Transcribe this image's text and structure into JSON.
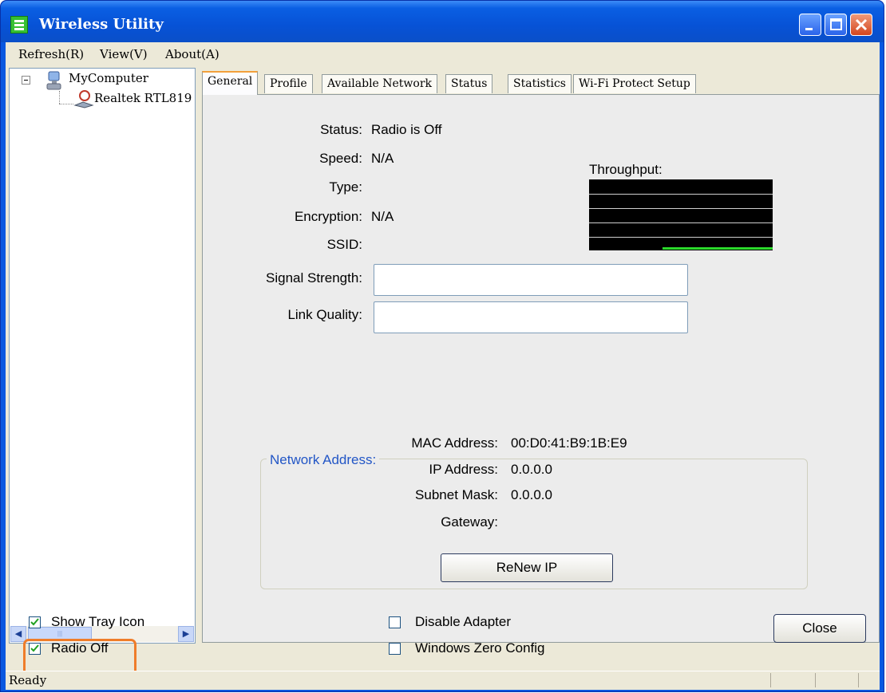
{
  "window": {
    "title": "Wireless Utility"
  },
  "menu": {
    "refresh": "Refresh(R)",
    "view": "View(V)",
    "about": "About(A)"
  },
  "tree": {
    "root": "MyComputer",
    "child": "Realtek RTL819"
  },
  "tabs": [
    "General",
    "Profile",
    "Available Network",
    "Status",
    "Statistics",
    "Wi-Fi Protect Setup"
  ],
  "general": {
    "status_label": "Status:",
    "status_value": "Radio is Off",
    "speed_label": "Speed:",
    "speed_value": "N/A",
    "type_label": "Type:",
    "type_value": "",
    "encryption_label": "Encryption:",
    "encryption_value": "N/A",
    "ssid_label": "SSID:",
    "ssid_value": "",
    "throughput_label": "Throughput:",
    "signal_label": "Signal Strength:",
    "link_label": "Link Quality:",
    "network_title": "Network Address:",
    "mac_label": "MAC Address:",
    "mac_value": "00:D0:41:B9:1B:E9",
    "ip_label": "IP Address:",
    "ip_value": "0.0.0.0",
    "subnet_label": "Subnet Mask:",
    "subnet_value": "0.0.0.0",
    "gateway_label": "Gateway:",
    "gateway_value": "",
    "renew_label": "ReNew IP"
  },
  "bottom": {
    "show_tray": "Show Tray Icon",
    "show_tray_checked": true,
    "radio_off": "Radio Off",
    "radio_off_checked": true,
    "disable_adapter": "Disable Adapter",
    "disable_adapter_checked": false,
    "zero_config": "Windows Zero Config",
    "zero_config_checked": false,
    "close": "Close"
  },
  "status_bar": {
    "text": "Ready"
  },
  "colors": {
    "title_bar": "#0a5fe3",
    "group_title": "#2256c6",
    "highlight": "#ef7d2a",
    "throughput_line": "#2bd82b"
  },
  "icons": [
    "app-icon",
    "minimize-icon",
    "maximize-icon",
    "close-icon",
    "computer-icon",
    "network-adapter-icon",
    "checkmark-icon"
  ]
}
